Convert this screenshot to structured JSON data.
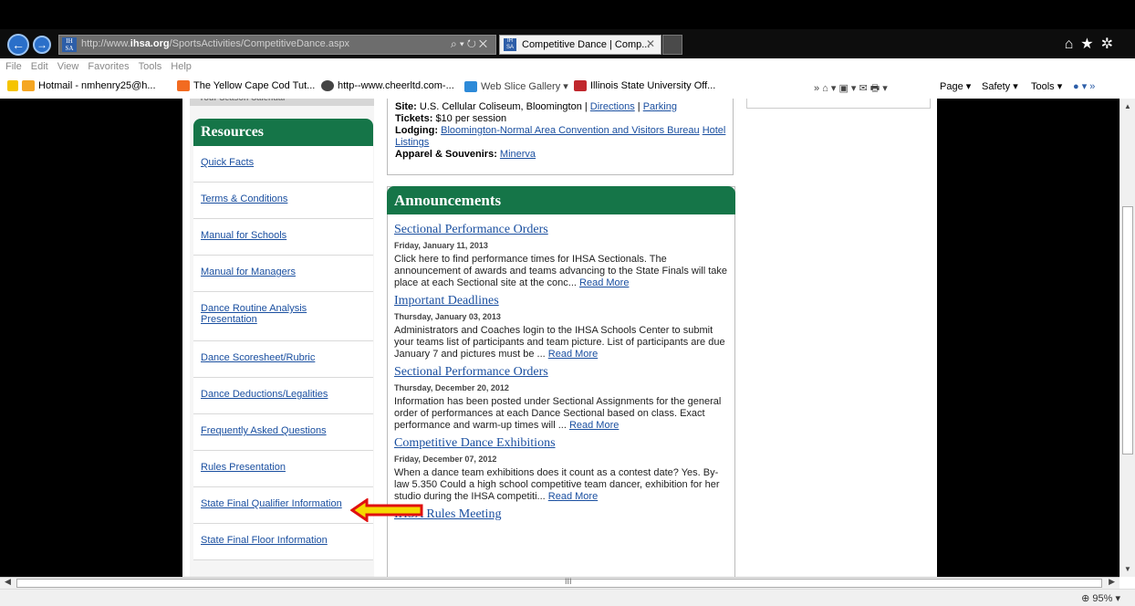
{
  "browser": {
    "address_url_prefix": "http://www.",
    "address_url_domain": "ihsa.org",
    "address_url_path": "/SportsActivities/CompetitiveDance.aspx",
    "tab_title": "Competitive Dance | Comp...",
    "favicon_text": "IH SA",
    "menu": [
      "File",
      "Edit",
      "View",
      "Favorites",
      "Tools",
      "Help"
    ],
    "favorites": [
      {
        "label": "Hotmail - nmhenry25@h...",
        "color": "#f5a623"
      },
      {
        "label": "The Yellow Cape Cod Tut...",
        "color": "#f26b21"
      },
      {
        "label": "http--www.cheerltd.com-...",
        "color": "#444444"
      },
      {
        "label": "Web Slice Gallery ▾",
        "color": "#2d8ad8"
      },
      {
        "label": "Illinois State University Off...",
        "color": "#c0272d"
      }
    ],
    "command_items": [
      "Page ▾",
      "Safety ▾",
      "Tools ▾"
    ],
    "zoom": "95%"
  },
  "sidebar": {
    "old_header": "Your Season Calendar",
    "resources_title": "Resources",
    "items": [
      "Quick Facts",
      "Terms & Conditions",
      "Manual for Schools",
      "Manual for Managers",
      "Dance Routine Analysis Presentation",
      "Dance Scoresheet/Rubric",
      "Dance Deductions/Legalities",
      "Frequently Asked Questions ",
      "Rules Presentation",
      "State Final Qualifier Information",
      "State Final Floor Information"
    ]
  },
  "info": {
    "site_label": "Site:",
    "site_text": "U.S. Cellular Coliseum, Bloomington | ",
    "directions": "Directions",
    "sep": " | ",
    "parking": "Parking",
    "tickets_label": "Tickets:",
    "tickets_text": "$10 per session",
    "lodging_label": "Lodging:",
    "lodging_link1": "Bloomington-Normal Area Convention and Visitors Bureau",
    "lodging_link2": "Hotel Listings",
    "apparel_label": "Apparel & Souvenirs:",
    "apparel_link": "Minerva"
  },
  "announcements": {
    "title": "Announcements",
    "read_more": "Read More",
    "items": [
      {
        "title": "Sectional Performance Orders",
        "date": "Friday, January 11, 2013",
        "body": "Click here to find performance times for IHSA Sectionals. The announcement of awards and teams advancing to the State Finals will take place at each Sectional site at the conc... "
      },
      {
        "title": "Important Deadlines",
        "date": "Thursday, January 03, 2013",
        "body": "Administrators and Coaches login to the IHSA Schools Center to submit your teams list of participants and team picture. List of participants are due January 7 and pictures must be ... "
      },
      {
        "title": "Sectional Performance Orders",
        "date": "Thursday, December 20, 2012",
        "body": "Information has been posted under Sectional Assignments for the general order of performances at each Dance Sectional based on class. Exact performance and warm-up times will ... "
      },
      {
        "title": "Competitive Dance Exhibitions",
        "date": "Friday, December 07, 2012",
        "body": "When a dance team exhibitions does it count as a contest date? Yes. By-law 5.350 Could a high school competitive team dancer, exhibition for her studio during the IHSA competiti... "
      },
      {
        "title": "IHSA Rules Meeting",
        "date": "",
        "body": ""
      }
    ]
  },
  "colors": {
    "accent_green": "#157548",
    "link_blue": "#1a4fa0",
    "arrow_fill": "#f5d800",
    "arrow_stroke": "#e01010"
  }
}
